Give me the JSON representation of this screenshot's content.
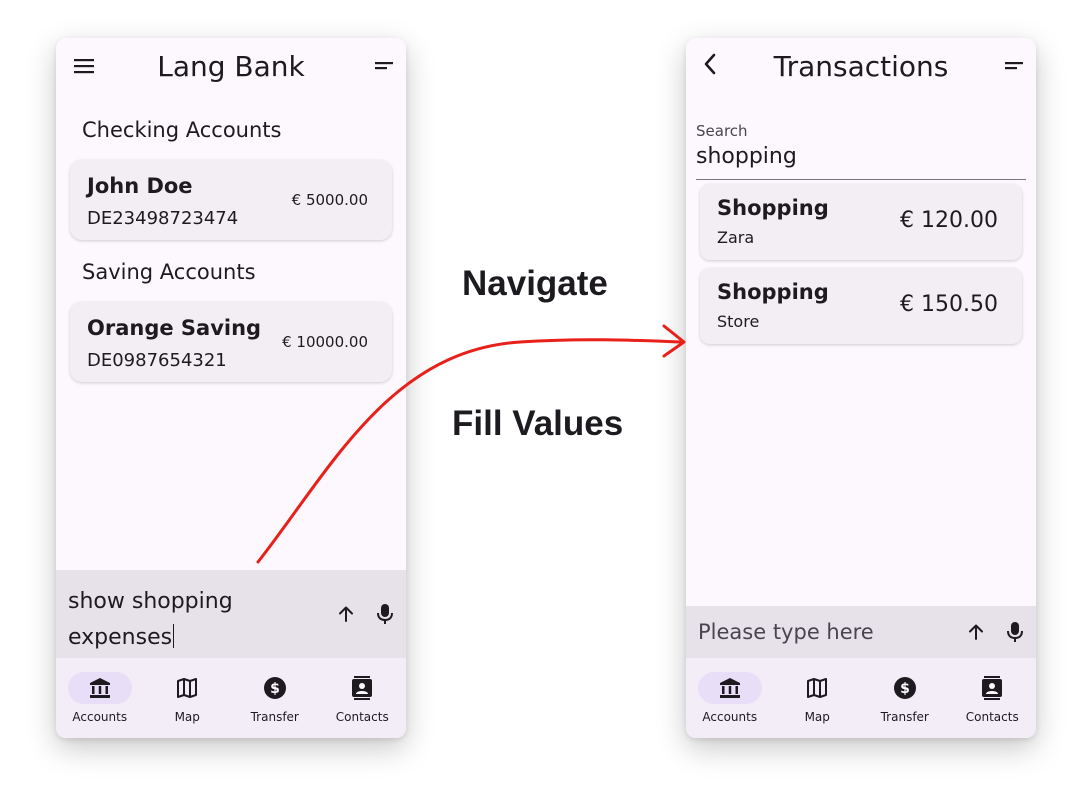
{
  "left_screen": {
    "title": "Lang Bank",
    "sections": [
      {
        "title": "Checking Accounts",
        "account": {
          "name": "John Doe",
          "iban": "DE23498723474",
          "balance": "€ 5000.00"
        }
      },
      {
        "title": "Saving Accounts",
        "account": {
          "name": "Orange Saving",
          "iban": "DE0987654321",
          "balance": "€ 10000.00"
        }
      }
    ],
    "chat_input": {
      "value": "show shopping expenses"
    }
  },
  "right_screen": {
    "title": "Transactions",
    "search": {
      "label": "Search",
      "value": "shopping"
    },
    "transactions": [
      {
        "category": "Shopping",
        "merchant": "Zara",
        "amount": "€ 120.00"
      },
      {
        "category": "Shopping",
        "merchant": "Store",
        "amount": "€ 150.50"
      }
    ],
    "chat_input": {
      "placeholder": "Please type here"
    }
  },
  "nav": {
    "items": [
      {
        "label": "Accounts",
        "icon": "bank-icon",
        "active": true
      },
      {
        "label": "Map",
        "icon": "map-icon",
        "active": false
      },
      {
        "label": "Transfer",
        "icon": "dollar-icon",
        "active": false
      },
      {
        "label": "Contacts",
        "icon": "contacts-icon",
        "active": false
      }
    ]
  },
  "captions": {
    "navigate": "Navigate",
    "fill_values": "Fill Values"
  },
  "colors": {
    "arrow": "#e8201a",
    "card_bg": "#f3eef4",
    "input_bg": "#e7e1e9",
    "nav_bg": "#f3edf7",
    "nav_active_pill": "#e8def8"
  }
}
